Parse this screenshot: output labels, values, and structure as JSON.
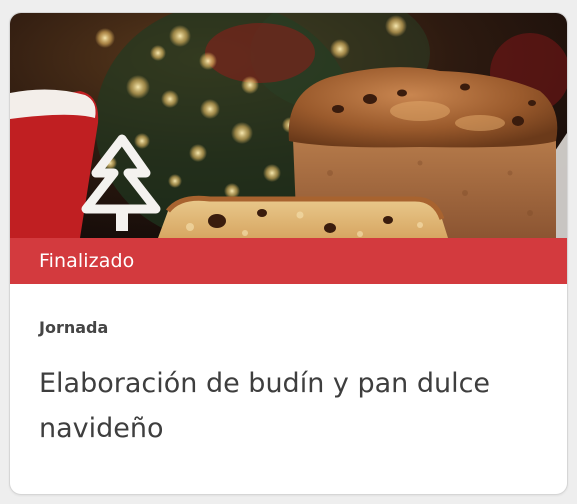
{
  "card": {
    "image": {
      "subject": "panettone-christmas-photo"
    },
    "status": {
      "label": "Finalizado",
      "color": "#d33a3e"
    },
    "category": "Jornada",
    "title": "Elaboración de budín y pan dulce navideño"
  }
}
